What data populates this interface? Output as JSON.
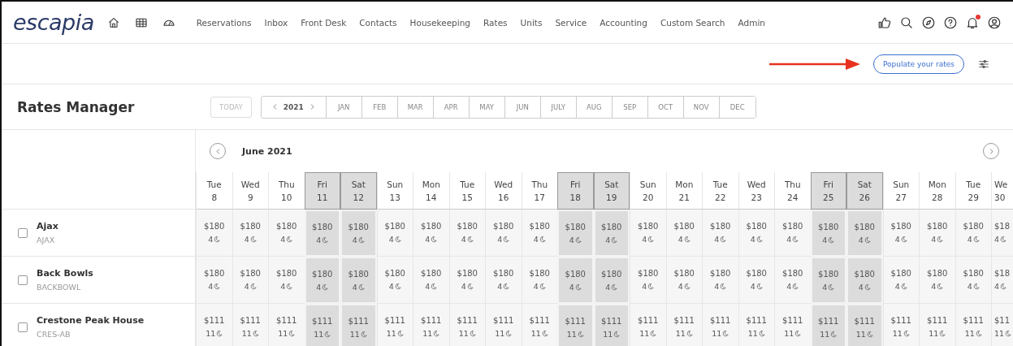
{
  "logo": "escapia",
  "nav": [
    "Reservations",
    "Inbox",
    "Front Desk",
    "Contacts",
    "Housekeeping",
    "Rates",
    "Units",
    "Service",
    "Accounting",
    "Custom Search",
    "Admin"
  ],
  "notifications": {
    "unread": true
  },
  "toolbar": {
    "button": "Populate your rates"
  },
  "page_title": "Rates Manager",
  "today_button": {
    "label": "TODAY",
    "disabled": true
  },
  "year": "2021",
  "months": [
    "JAN",
    "FEB",
    "MAR",
    "APR",
    "MAY",
    "JUN",
    "JULY",
    "AUG",
    "SEP",
    "OCT",
    "NOV",
    "DEC"
  ],
  "month_title": "June 2021",
  "days": [
    {
      "day": "Tue",
      "date": "8",
      "weekend": false
    },
    {
      "day": "Wed",
      "date": "9",
      "weekend": false
    },
    {
      "day": "Thu",
      "date": "10",
      "weekend": false
    },
    {
      "day": "Fri",
      "date": "11",
      "weekend": true
    },
    {
      "day": "Sat",
      "date": "12",
      "weekend": true
    },
    {
      "day": "Sun",
      "date": "13",
      "weekend": false
    },
    {
      "day": "Mon",
      "date": "14",
      "weekend": false
    },
    {
      "day": "Tue",
      "date": "15",
      "weekend": false
    },
    {
      "day": "Wed",
      "date": "16",
      "weekend": false
    },
    {
      "day": "Thu",
      "date": "17",
      "weekend": false
    },
    {
      "day": "Fri",
      "date": "18",
      "weekend": true
    },
    {
      "day": "Sat",
      "date": "19",
      "weekend": true
    },
    {
      "day": "Sun",
      "date": "20",
      "weekend": false
    },
    {
      "day": "Mon",
      "date": "21",
      "weekend": false
    },
    {
      "day": "Tue",
      "date": "22",
      "weekend": false
    },
    {
      "day": "Wed",
      "date": "23",
      "weekend": false
    },
    {
      "day": "Thu",
      "date": "24",
      "weekend": false
    },
    {
      "day": "Fri",
      "date": "25",
      "weekend": true
    },
    {
      "day": "Sat",
      "date": "26",
      "weekend": true
    },
    {
      "day": "Sun",
      "date": "27",
      "weekend": false
    },
    {
      "day": "Mon",
      "date": "28",
      "weekend": false
    },
    {
      "day": "Tue",
      "date": "29",
      "weekend": false
    },
    {
      "day": "We",
      "date": "30",
      "weekend": false
    }
  ],
  "units": [
    {
      "name": "Ajax",
      "code": "AJAX",
      "checked": false,
      "cells": [
        {
          "rate": "$180",
          "nights": "4"
        },
        {
          "rate": "$180",
          "nights": "4"
        },
        {
          "rate": "$180",
          "nights": "4"
        },
        {
          "rate": "$180",
          "nights": "4"
        },
        {
          "rate": "$180",
          "nights": "4"
        },
        {
          "rate": "$180",
          "nights": "4"
        },
        {
          "rate": "$180",
          "nights": "4"
        },
        {
          "rate": "$180",
          "nights": "4"
        },
        {
          "rate": "$180",
          "nights": "4"
        },
        {
          "rate": "$180",
          "nights": "4"
        },
        {
          "rate": "$180",
          "nights": "4"
        },
        {
          "rate": "$180",
          "nights": "4"
        },
        {
          "rate": "$180",
          "nights": "4"
        },
        {
          "rate": "$180",
          "nights": "4"
        },
        {
          "rate": "$180",
          "nights": "4"
        },
        {
          "rate": "$180",
          "nights": "4"
        },
        {
          "rate": "$180",
          "nights": "4"
        },
        {
          "rate": "$180",
          "nights": "4"
        },
        {
          "rate": "$180",
          "nights": "4"
        },
        {
          "rate": "$180",
          "nights": "4"
        },
        {
          "rate": "$180",
          "nights": "4"
        },
        {
          "rate": "$180",
          "nights": "4"
        },
        {
          "rate": "$18",
          "nights": "4"
        }
      ]
    },
    {
      "name": "Back Bowls",
      "code": "BACKBOWL",
      "checked": false,
      "cells": [
        {
          "rate": "$180",
          "nights": "4"
        },
        {
          "rate": "$180",
          "nights": "4"
        },
        {
          "rate": "$180",
          "nights": "4"
        },
        {
          "rate": "$180",
          "nights": "4"
        },
        {
          "rate": "$180",
          "nights": "4"
        },
        {
          "rate": "$180",
          "nights": "4"
        },
        {
          "rate": "$180",
          "nights": "4"
        },
        {
          "rate": "$180",
          "nights": "4"
        },
        {
          "rate": "$180",
          "nights": "4"
        },
        {
          "rate": "$180",
          "nights": "4"
        },
        {
          "rate": "$180",
          "nights": "4"
        },
        {
          "rate": "$180",
          "nights": "4"
        },
        {
          "rate": "$180",
          "nights": "4"
        },
        {
          "rate": "$180",
          "nights": "4"
        },
        {
          "rate": "$180",
          "nights": "4"
        },
        {
          "rate": "$180",
          "nights": "4"
        },
        {
          "rate": "$180",
          "nights": "4"
        },
        {
          "rate": "$180",
          "nights": "4"
        },
        {
          "rate": "$180",
          "nights": "4"
        },
        {
          "rate": "$180",
          "nights": "4"
        },
        {
          "rate": "$180",
          "nights": "4"
        },
        {
          "rate": "$180",
          "nights": "4"
        },
        {
          "rate": "$18",
          "nights": "4"
        }
      ]
    },
    {
      "name": "Crestone Peak House",
      "code": "CRES-AB",
      "checked": false,
      "cells": [
        {
          "rate": "$111",
          "nights": "11"
        },
        {
          "rate": "$111",
          "nights": "11"
        },
        {
          "rate": "$111",
          "nights": "11"
        },
        {
          "rate": "$111",
          "nights": "11"
        },
        {
          "rate": "$111",
          "nights": "11"
        },
        {
          "rate": "$111",
          "nights": "11"
        },
        {
          "rate": "$111",
          "nights": "11"
        },
        {
          "rate": "$111",
          "nights": "11"
        },
        {
          "rate": "$111",
          "nights": "11"
        },
        {
          "rate": "$111",
          "nights": "11"
        },
        {
          "rate": "$111",
          "nights": "11"
        },
        {
          "rate": "$111",
          "nights": "11"
        },
        {
          "rate": "$111",
          "nights": "11"
        },
        {
          "rate": "$111",
          "nights": "11"
        },
        {
          "rate": "$111",
          "nights": "11"
        },
        {
          "rate": "$111",
          "nights": "11"
        },
        {
          "rate": "$111",
          "nights": "11"
        },
        {
          "rate": "$111",
          "nights": "11"
        },
        {
          "rate": "$111",
          "nights": "11"
        },
        {
          "rate": "$111",
          "nights": "11"
        },
        {
          "rate": "$111",
          "nights": "11"
        },
        {
          "rate": "$111",
          "nights": "11"
        },
        {
          "rate": "$11",
          "nights": "11"
        }
      ]
    }
  ]
}
